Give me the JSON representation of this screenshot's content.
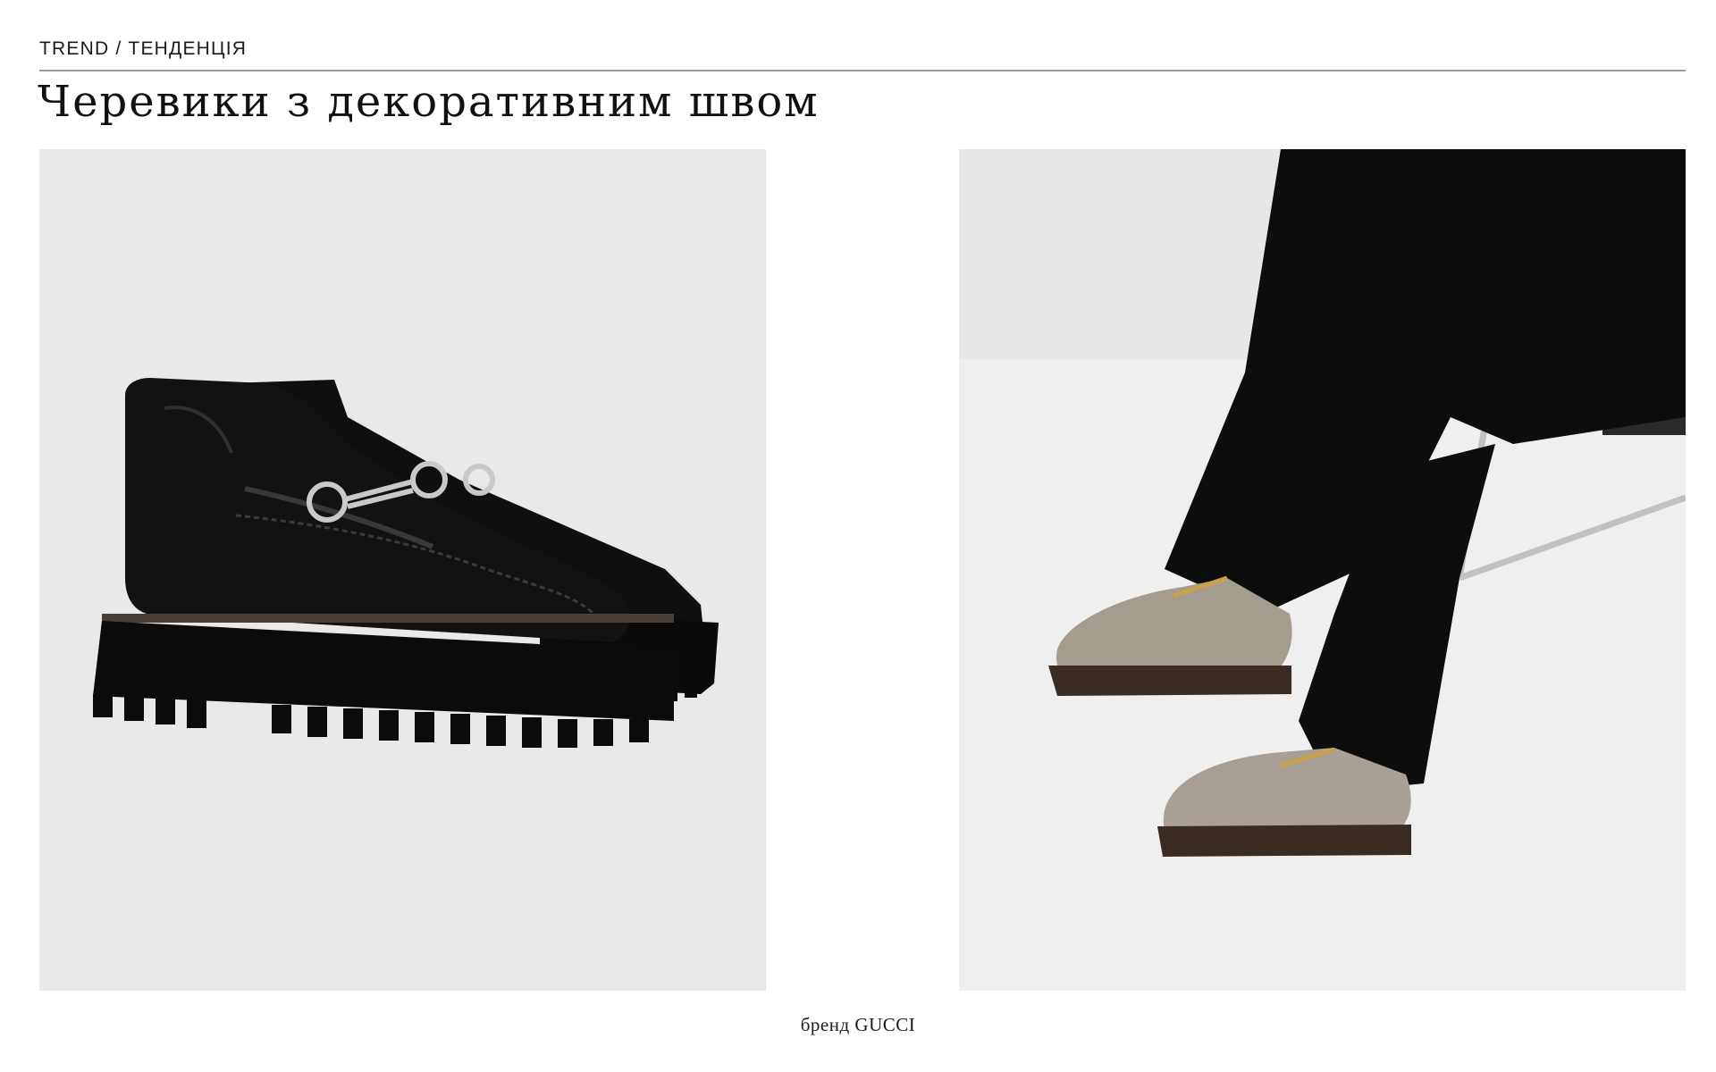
{
  "header": {
    "kicker": "TREND / ТЕНДЕНЦІЯ",
    "title": "Черевики з декоративним швом"
  },
  "caption": "бренд GUCCI",
  "colors": {
    "accent_rule": "#9a9a9a",
    "left_photo_bg": "#e9e9ea",
    "right_photo_bg": "#f0f0f0"
  }
}
